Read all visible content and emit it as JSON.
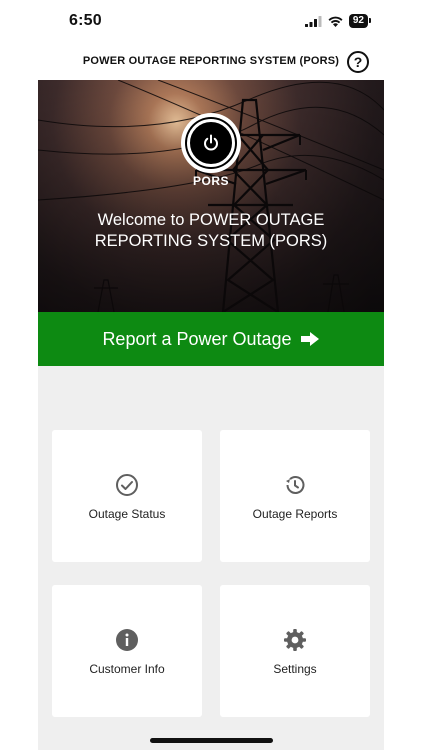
{
  "status_bar": {
    "time": "6:50",
    "battery": "92"
  },
  "header": {
    "title": "POWER OUTAGE REPORTING SYSTEM (PORS)",
    "help_icon": "question-circle-icon"
  },
  "hero": {
    "logo_text": "PORS",
    "welcome": "Welcome to POWER OUTAGE REPORTING SYSTEM (PORS)"
  },
  "cta": {
    "label": "Report a Power Outage",
    "color": "#0d8a12",
    "icon": "arrow-right-icon"
  },
  "tiles": [
    {
      "label": "Outage Status",
      "icon": "check-circle-icon"
    },
    {
      "label": "Outage Reports",
      "icon": "history-icon"
    },
    {
      "label": "Customer Info",
      "icon": "info-icon"
    },
    {
      "label": "Settings",
      "icon": "gear-icon"
    }
  ]
}
